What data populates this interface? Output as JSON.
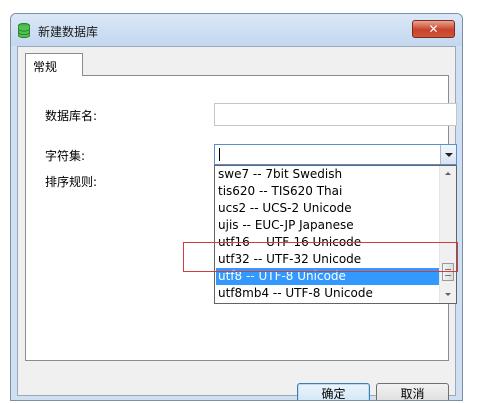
{
  "window": {
    "title": "新建数据库",
    "close_label": "✕"
  },
  "tabs": [
    {
      "label": "常规"
    }
  ],
  "form": {
    "db_name_label": "数据库名:",
    "db_name_value": "",
    "charset_label": "字符集:",
    "charset_value": "",
    "collation_label": "排序规则:"
  },
  "charset_options": [
    {
      "label": "swe7 -- 7bit Swedish"
    },
    {
      "label": "tis620 -- TIS620 Thai"
    },
    {
      "label": "ucs2 -- UCS-2 Unicode"
    },
    {
      "label": "ujis -- EUC-JP Japanese"
    },
    {
      "label": "utf16 -- UTF-16 Unicode"
    },
    {
      "label": "utf32 -- UTF-32 Unicode"
    },
    {
      "label": "utf8 -- UTF-8 Unicode",
      "selected": true
    },
    {
      "label": "utf8mb4 -- UTF-8 Unicode"
    }
  ],
  "buttons": {
    "ok_label": "确定",
    "cancel_label": "取消"
  },
  "colors": {
    "selection": "#3399ff",
    "highlight_box": "#d63b3b",
    "title_gradient_top": "#dbe8f7",
    "close_button": "#c8432a"
  }
}
